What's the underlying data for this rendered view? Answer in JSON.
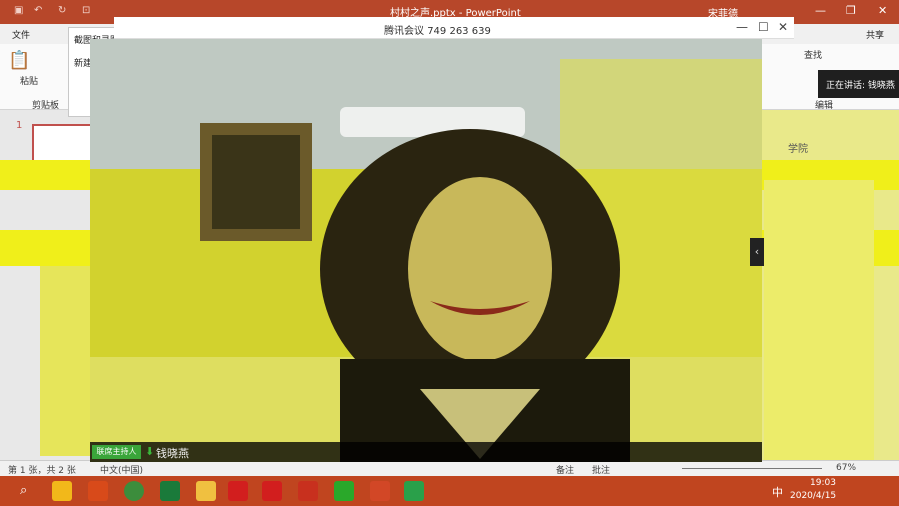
{
  "ppt": {
    "file_title": "村村之声.pptx - PowerPoint",
    "user": "宋菲德",
    "tab_file": "文件",
    "paste_label": "粘贴",
    "clipboard_group": "剪贴板",
    "find_label": "查找",
    "edit_group": "编辑",
    "share_label": "共享",
    "slide_number": "1",
    "status_slide": "第 1 张，共 2 张",
    "status_language": "中文(中国)",
    "status_notes": "备注",
    "status_comments": "批注",
    "zoom": "67%",
    "college_fragment": "学院"
  },
  "popup": {
    "item1": "截图和录图",
    "item2": "新建"
  },
  "meeting": {
    "title_prefix": "腾讯会议",
    "meeting_id": "749 263 639",
    "speaking_label": "正在讲话: 钱晓燕",
    "host_badge": "联席主持人",
    "participant_name": "钱晓燕"
  },
  "taskbar": {
    "ime": "中",
    "time": "19:03",
    "date": "2020/4/15"
  },
  "colors": {
    "ppt_accent": "#b7472a",
    "video_tint": "#d4d42a",
    "host_green": "#3aa53a"
  }
}
